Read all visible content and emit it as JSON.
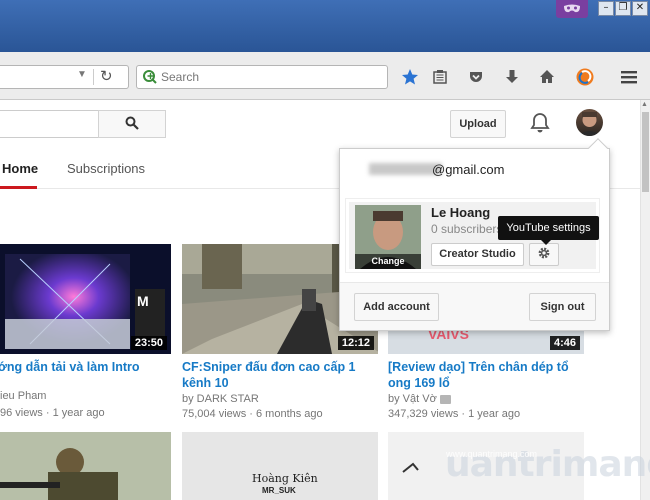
{
  "browser": {
    "search_placeholder": "Search",
    "window_controls": [
      "minimize",
      "restore",
      "close"
    ],
    "toolbar_icons": [
      "star-icon",
      "reading-list-icon",
      "pocket-icon",
      "download-icon",
      "home-icon",
      "sync-icon",
      "menu-icon"
    ]
  },
  "header": {
    "upload_label": "Upload"
  },
  "tabs": [
    {
      "label": "Home",
      "active": true
    },
    {
      "label": "Subscriptions",
      "active": false
    }
  ],
  "videos": [
    {
      "title1": "ớng dẫn tải và làm Intro",
      "title2": "",
      "channel": "ieu Pham",
      "views": "96 views",
      "age": "1 year ago",
      "duration": "23:50"
    },
    {
      "title1": "CF:Sniper đấu đơn cao cấp 1",
      "title2": "kênh 10",
      "channel": "by DARK STAR",
      "views": "75,004 views",
      "age": "6 months ago",
      "duration": "12:12"
    },
    {
      "title1": "[Review dạo] Trên chân dép tổ",
      "title2": "ong 169 lổ",
      "channel": "by Vật Vờ",
      "views": "347,329 views",
      "age": "1 year ago",
      "duration": "4:46"
    }
  ],
  "bottom_row": {
    "thumb2_caption1": "Hoàng Kiên",
    "thumb2_caption2": "MR_SUK"
  },
  "account_popup": {
    "email_suffix": "@gmail.com",
    "name": "Le Hoang",
    "subscribers": "0 subscribers",
    "change_label": "Change",
    "creator_studio": "Creator Studio",
    "settings_tooltip": "YouTube settings",
    "add_account": "Add account",
    "sign_out": "Sign out"
  },
  "watermark": {
    "brand": "uantrimang",
    "url": "www.quantrimang.com"
  },
  "colors": {
    "titlebar": "#2f5e9f",
    "accent_red": "#cc181e",
    "link_blue": "#167ac6"
  }
}
